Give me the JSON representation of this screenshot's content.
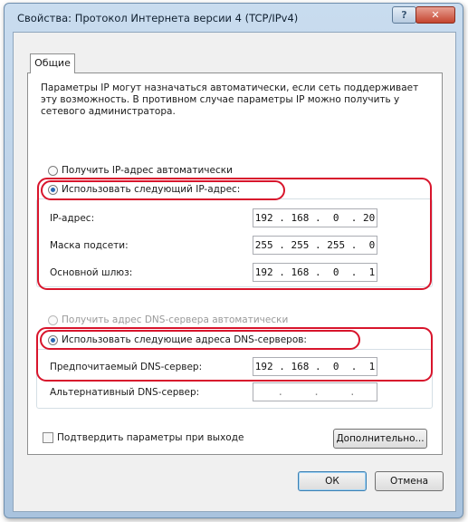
{
  "window": {
    "title": "Свойства: Протокол Интернета версии 4 (TCP/IPv4)",
    "help_label": "?",
    "close_label": "✕"
  },
  "tabs": [
    {
      "label": "Общие"
    }
  ],
  "description": "Параметры IP могут назначаться автоматически, если сеть поддерживает эту возможность. В противном случае параметры IP можно получить у сетевого администратора.",
  "ip_section": {
    "auto_label": "Получить IP-адрес автоматически",
    "manual_label": "Использовать следующий IP-адрес:",
    "fields": [
      {
        "label": "IP-адрес:",
        "value": "192 . 168 .  0  . 20"
      },
      {
        "label": "Маска подсети:",
        "value": "255 . 255 . 255 .  0"
      },
      {
        "label": "Основной шлюз:",
        "value": "192 . 168 .  0  .  1"
      }
    ]
  },
  "dns_section": {
    "auto_label": "Получить адрес DNS-сервера автоматически",
    "manual_label": "Использовать следующие адреса DNS-серверов:",
    "fields": [
      {
        "label": "Предпочитаемый DNS-сервер:",
        "value": "192 . 168 .  0  .  1"
      },
      {
        "label": "Альтернативный DNS-сервер:",
        "value": "    .     .     .    "
      }
    ]
  },
  "validate_label": "Подтвердить параметры при выходе",
  "buttons": {
    "advanced": "Дополнительно...",
    "ok": "ОК",
    "cancel": "Отмена"
  },
  "colors": {
    "highlight": "#d8152c",
    "radio_selected": "#2a6ab5",
    "titlebar": "#b9cfe6"
  }
}
